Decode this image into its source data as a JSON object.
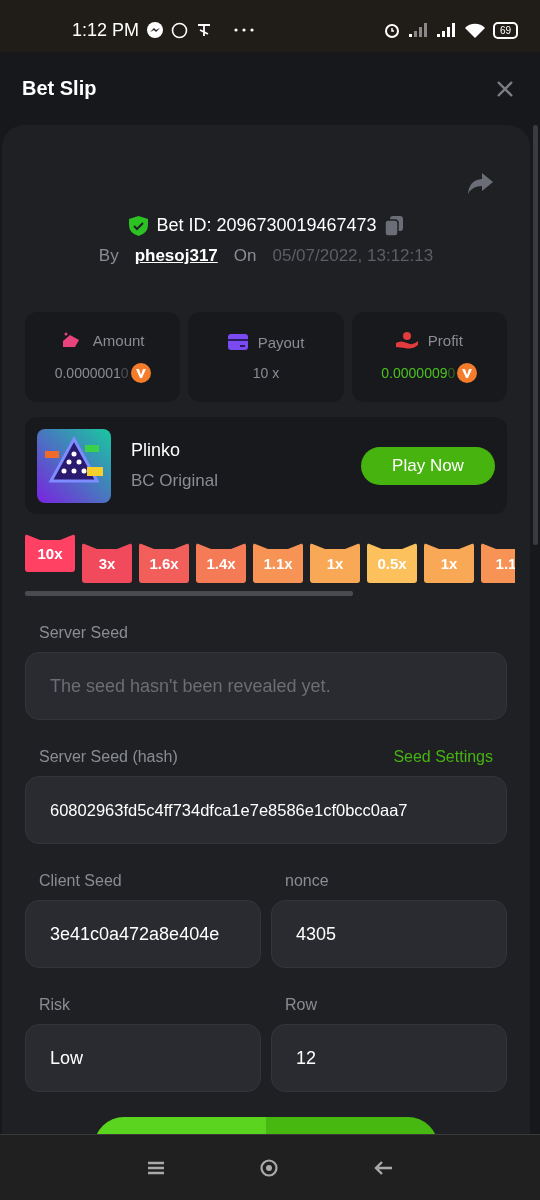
{
  "status_bar": {
    "time": "1:12 PM",
    "battery": "69"
  },
  "header": {
    "title": "Bet Slip"
  },
  "bet": {
    "id_label": "Bet ID: 2096730019467473",
    "by_label": "By",
    "user": "phesoj317",
    "on_label": "On",
    "date": "05/07/2022, 13:12:13"
  },
  "stats": [
    {
      "kind": "amount",
      "label": "Amount",
      "value": "0.0000001",
      "faded": "0",
      "coin": true
    },
    {
      "kind": "payout",
      "label": "Payout",
      "value": "10 x",
      "coin": false
    },
    {
      "kind": "profit",
      "label": "Profit",
      "value": "0.0000009",
      "faded": "0",
      "coin": true
    }
  ],
  "game": {
    "name": "Plinko",
    "provider": "BC Original",
    "button": "Play Now"
  },
  "multipliers": [
    {
      "label": "10x",
      "selected": true,
      "color": "#f23c5c"
    },
    {
      "label": "3x",
      "selected": false,
      "color": "#f04a5c"
    },
    {
      "label": "1.6x",
      "selected": false,
      "color": "#f25e5a"
    },
    {
      "label": "1.4x",
      "selected": false,
      "color": "#f57a56"
    },
    {
      "label": "1.1x",
      "selected": false,
      "color": "#f79455"
    },
    {
      "label": "1x",
      "selected": false,
      "color": "#f9a855"
    },
    {
      "label": "0.5x",
      "selected": false,
      "color": "#fcc05c"
    },
    {
      "label": "1x",
      "selected": false,
      "color": "#f9a855"
    },
    {
      "label": "1.1",
      "selected": false,
      "color": "#f79455"
    }
  ],
  "server_seed": {
    "label": "Server Seed",
    "placeholder": "The seed hasn't been revealed yet."
  },
  "server_seed_hash": {
    "label": "Server Seed (hash)",
    "link": "Seed Settings",
    "value": "60802963fd5c4ff734dfca1e7e8586e1cf0bcc0aa7"
  },
  "pairs": [
    [
      {
        "label": "Client Seed",
        "value": "3e41c0a472a8e404e"
      },
      {
        "label": "nonce",
        "value": "4305"
      }
    ],
    [
      {
        "label": "Risk",
        "value": "Low"
      },
      {
        "label": "Row",
        "value": "12"
      }
    ]
  ]
}
